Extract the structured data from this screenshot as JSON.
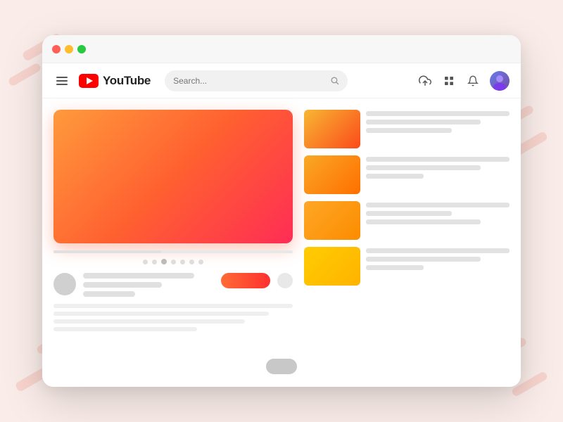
{
  "background": {
    "color": "#f9ece9"
  },
  "titleBar": {
    "dots": [
      "red",
      "yellow",
      "green"
    ]
  },
  "navbar": {
    "menuLabel": "Menu",
    "brandName": "YouTube",
    "searchPlaceholder": "Search...",
    "icons": {
      "upload": "upload-icon",
      "grid": "grid-icon",
      "bell": "bell-icon",
      "avatar": "avatar-icon"
    }
  },
  "videoPlayer": {
    "gradientStart": "#ff9a3c",
    "gradientEnd": "#ff2d55"
  },
  "progressDots": [
    {
      "active": false
    },
    {
      "active": false
    },
    {
      "active": true
    },
    {
      "active": false
    },
    {
      "active": false
    },
    {
      "active": false
    },
    {
      "active": false
    }
  ],
  "recommendedVideos": [
    {
      "thumbClass": "rec-thumb-1"
    },
    {
      "thumbClass": "rec-thumb-2"
    },
    {
      "thumbClass": "rec-thumb-3"
    },
    {
      "thumbClass": "rec-thumb-4"
    }
  ],
  "scrollbar": {
    "visible": true
  }
}
